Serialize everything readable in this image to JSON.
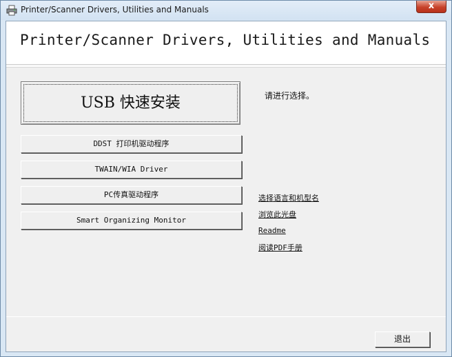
{
  "window": {
    "title": "Printer/Scanner Drivers, Utilities and Manuals",
    "close_label": "x"
  },
  "header": {
    "title": "Printer/Scanner Drivers, Utilities and Manuals"
  },
  "buttons": {
    "usb_quick_install": "USB 快速安装",
    "ddst_driver": "DDST 打印机驱动程序",
    "twain_wia": "TWAIN/WIA Driver",
    "pc_fax": "PC传真驱动程序",
    "smart_monitor": "Smart Organizing Monitor"
  },
  "prompt": "请进行选择。",
  "links": {
    "select_language_model": "选择语言和机型名",
    "browse_cd": "浏览此光盘",
    "readme": "Readme",
    "read_pdf_manual": "阅读PDF手册"
  },
  "footer": {
    "exit_label": "退出"
  },
  "icons": {
    "app": "printer-icon"
  }
}
